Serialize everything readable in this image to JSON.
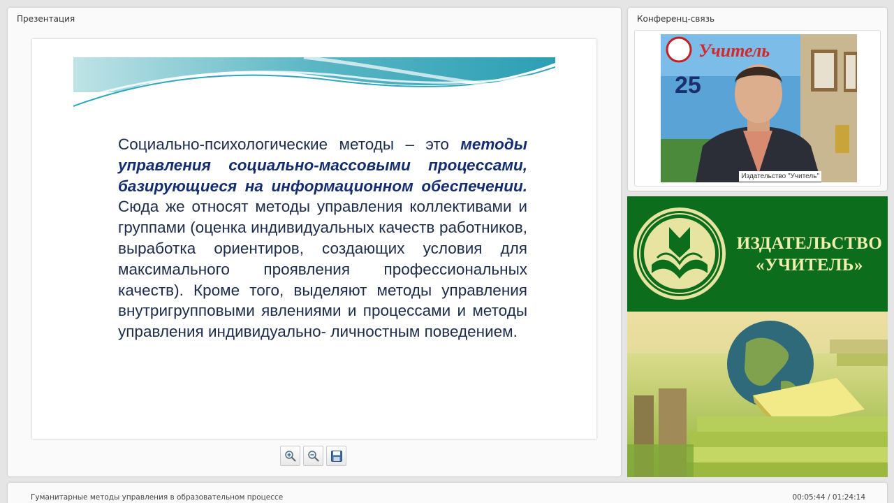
{
  "presentation": {
    "title": "Презентация",
    "slide": {
      "p1": "Социально-психологические методы – это ",
      "p2_bold": "методы управления социально-массовыми процессами, базирующиеся на информационном обеспечении.",
      "p3": " Сюда же относят методы управления коллективами и группами (оценка индивидуальных качеств работников, выработка ориентиров, создающих условия для максимального проявления профессиональных качеств). Кроме того, выделяют методы управления внутригрупповыми явлениями и процессами и методы управления индивидуально- личностным поведением."
    },
    "toolbar": {
      "buttons": [
        "zoom-in-icon",
        "zoom-out-icon",
        "save-icon"
      ]
    }
  },
  "conference": {
    "title": "Конференц-связь",
    "video_label": "Издательство \"Учитель\"",
    "banner_text": "Учитель",
    "banner_number": "25"
  },
  "ad": {
    "publisher_line1": "ИЗДАТЕЛЬСТВО",
    "publisher_line2": "«УЧИТЕЛЬ»"
  },
  "footer": {
    "course_title": "Гуманитарные методы управления в образовательном процессе",
    "time": "00:05:44 / 01:24:14"
  },
  "colors": {
    "slide_text": "#1c2b4a",
    "slide_emphasis": "#142d6e",
    "ad_green": "#0c6d1c",
    "ad_gold": "#f1efb0"
  }
}
